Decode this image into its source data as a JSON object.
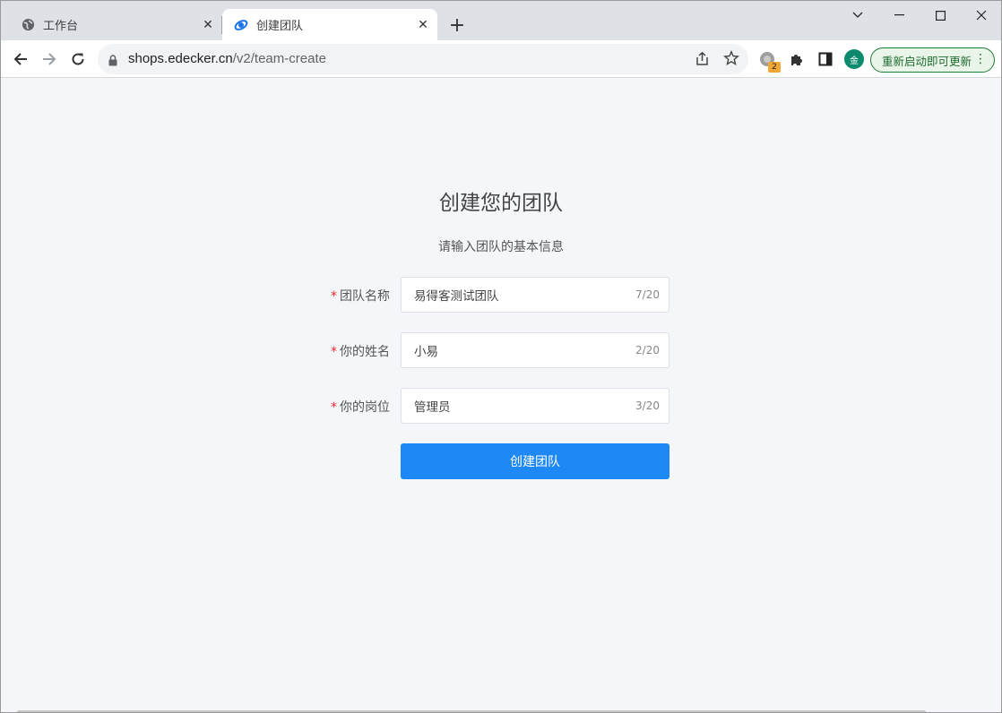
{
  "browser": {
    "tabs": [
      {
        "title": "工作台",
        "icon": "globe-icon",
        "active": false
      },
      {
        "title": "创建团队",
        "icon": "edecker-logo-icon",
        "active": true
      }
    ],
    "address_bar": {
      "host": "shops.edecker.cn",
      "path": "/v2/team-create"
    },
    "extension_badge": "2",
    "profile_initial": "金",
    "update_button_label": "重新启动即可更新",
    "accent_color": "#1e88f5"
  },
  "page": {
    "heading": "创建您的团队",
    "subheading": "请输入团队的基本信息",
    "form": {
      "team_name": {
        "label": "团队名称",
        "value": "易得客测试团队",
        "count": "7/20",
        "required": "*"
      },
      "your_name": {
        "label": "你的姓名",
        "value": "小易",
        "count": "2/20",
        "required": "*"
      },
      "your_position": {
        "label": "你的岗位",
        "value": "管理员",
        "count": "3/20",
        "required": "*"
      }
    },
    "submit_label": "创建团队"
  }
}
